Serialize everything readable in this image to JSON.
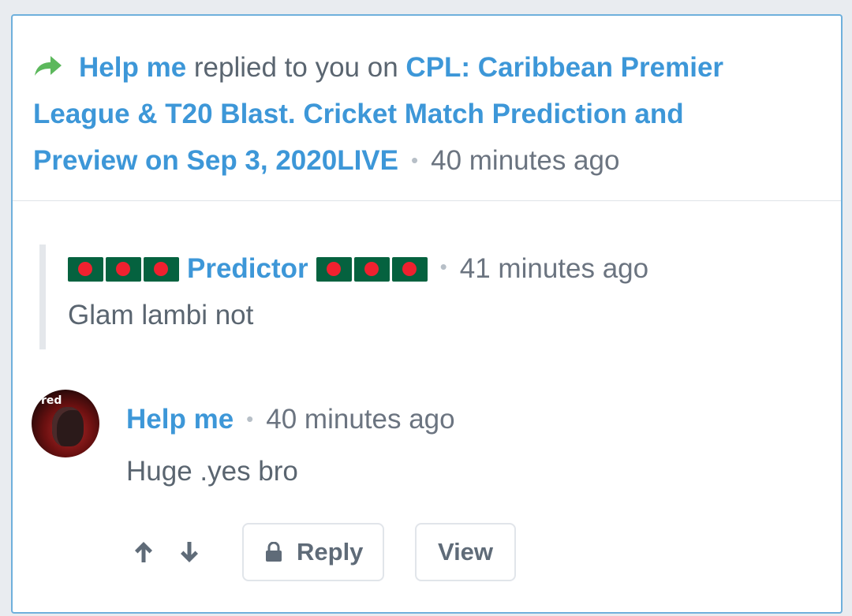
{
  "notification": {
    "actor": "Help me",
    "action_text": "replied to you on",
    "thread_title": "CPL: Caribbean Premier League & T20 Blast. Cricket Match Prediction and Preview on Sep 3, 2020LIVE",
    "separator": "•",
    "time": "40 minutes ago",
    "icon": "reply-arrow-icon",
    "icon_color": "#5cb85c"
  },
  "quoted_comment": {
    "author": "Predictor",
    "author_flags": "bangladesh-flag-icon",
    "separator": "•",
    "time": "41 minutes ago",
    "text": "Glam lambi not"
  },
  "reply_comment": {
    "author": "Help me",
    "avatar_icon": "user-avatar",
    "avatar_text": "red",
    "separator": "•",
    "time": "40 minutes ago",
    "text": "Huge .yes bro"
  },
  "actions": {
    "upvote_icon": "arrow-up-icon",
    "downvote_icon": "arrow-down-icon",
    "reply_label": "Reply",
    "reply_icon": "lock-icon",
    "view_label": "View"
  },
  "colors": {
    "link": "#3d97d8",
    "text": "#5a6570",
    "card_border": "#6fb0dc",
    "page_bg": "#e9ecf0"
  }
}
